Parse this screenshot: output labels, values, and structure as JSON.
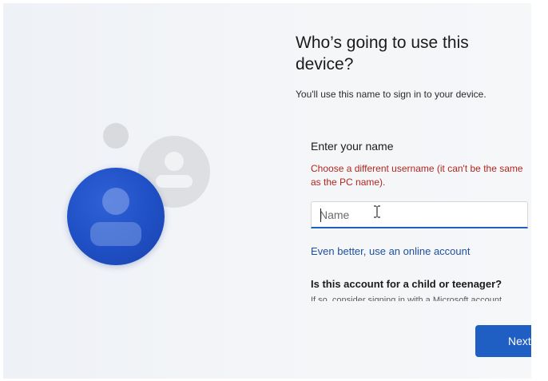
{
  "setup": {
    "title": "Who’s going to use this device?",
    "subtitle": "You'll use this name to sign in to your device.",
    "name_field": {
      "label": "Enter your name",
      "error": "Choose a different username (it can't be the same as the PC name).",
      "placeholder": "Name",
      "value": ""
    },
    "online_account_link": "Even better, use an online account",
    "child_question": "Is this account for a child or teenager?",
    "child_hint_partial": "If so, consider signing in with a Microsoft account",
    "next_button": "Next"
  },
  "icons": {
    "illustration": "users-illustration-icon",
    "cursor": "i-beam-cursor-icon"
  },
  "colors": {
    "accent": "#1f5fc4",
    "error": "#b3261e",
    "link": "#1f4f9f"
  }
}
